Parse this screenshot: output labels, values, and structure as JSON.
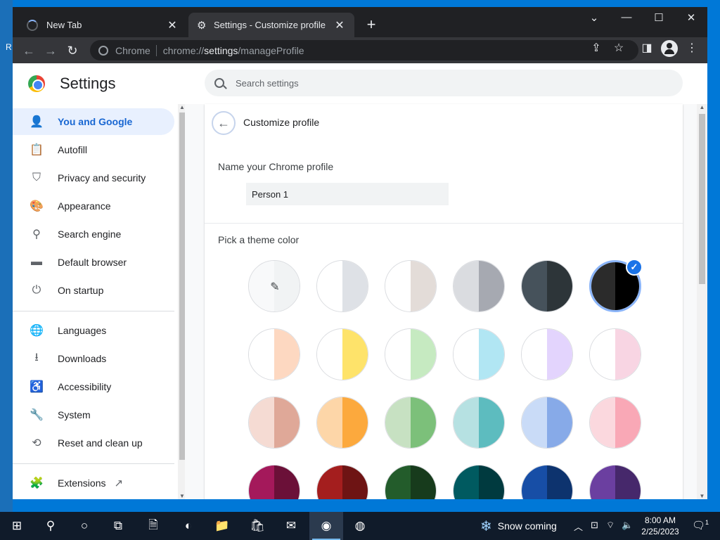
{
  "browser": {
    "tabs": [
      {
        "title": "New Tab",
        "state": "loading"
      },
      {
        "title": "Settings - Customize profile",
        "state": "active"
      }
    ],
    "omnibox": {
      "chip": "Chrome",
      "url_scheme": "chrome://",
      "url_host": "settings",
      "url_path": "/manageProfile"
    }
  },
  "settings": {
    "title": "Settings",
    "search_placeholder": "Search settings",
    "nav": {
      "items": [
        {
          "label": "You and Google",
          "icon": "person-icon",
          "selected": true
        },
        {
          "label": "Autofill",
          "icon": "clipboard-icon"
        },
        {
          "label": "Privacy and security",
          "icon": "shield-icon"
        },
        {
          "label": "Appearance",
          "icon": "palette-icon"
        },
        {
          "label": "Search engine",
          "icon": "search-icon"
        },
        {
          "label": "Default browser",
          "icon": "browser-window-icon"
        },
        {
          "label": "On startup",
          "icon": "power-icon"
        },
        {
          "label": "Languages",
          "icon": "globe-icon"
        },
        {
          "label": "Downloads",
          "icon": "download-icon"
        },
        {
          "label": "Accessibility",
          "icon": "accessibility-icon"
        },
        {
          "label": "System",
          "icon": "wrench-icon"
        },
        {
          "label": "Reset and clean up",
          "icon": "restore-icon"
        },
        {
          "label": "Extensions",
          "icon": "puzzle-icon"
        }
      ]
    },
    "page": {
      "title": "Customize profile",
      "name_label": "Name your Chrome profile",
      "name_value": "Person 1",
      "theme_label": "Pick a theme color"
    },
    "theme_colors": {
      "selected_index": 5,
      "swatches": [
        {
          "left": "#f8f9fa",
          "right": "#f1f3f4",
          "custom": true
        },
        {
          "left": "#ffffff",
          "right": "#dee1e6"
        },
        {
          "left": "#ffffff",
          "right": "#e3dcd8"
        },
        {
          "left": "#dadce0",
          "right": "#a6a9b1"
        },
        {
          "left": "#46525b",
          "right": "#2d3539"
        },
        {
          "left": "#2b2b2b",
          "right": "#000000"
        },
        {
          "left": "#ffffff",
          "right": "#fdd8c1"
        },
        {
          "left": "#ffffff",
          "right": "#fee36a"
        },
        {
          "left": "#ffffff",
          "right": "#c6eac1"
        },
        {
          "left": "#ffffff",
          "right": "#b1e6f3"
        },
        {
          "left": "#ffffff",
          "right": "#e3d4fd"
        },
        {
          "left": "#ffffff",
          "right": "#f8d5e3"
        },
        {
          "left": "#f5dbd3",
          "right": "#dfa898"
        },
        {
          "left": "#fdd6a8",
          "right": "#fca93d"
        },
        {
          "left": "#c7e1c2",
          "right": "#7cc07a"
        },
        {
          "left": "#b6e1e2",
          "right": "#5dbcbf"
        },
        {
          "left": "#c9dbf7",
          "right": "#87aae8"
        },
        {
          "left": "#fbd8de",
          "right": "#f9a8b6"
        },
        {
          "left": "#a4195b",
          "right": "#6b1038"
        },
        {
          "left": "#a41e1e",
          "right": "#6e1414"
        },
        {
          "left": "#235c2b",
          "right": "#173b1c"
        },
        {
          "left": "#005a60",
          "right": "#003a3f"
        },
        {
          "left": "#174ea6",
          "right": "#0d336e"
        },
        {
          "left": "#6b3fa0",
          "right": "#46286b"
        }
      ]
    }
  },
  "taskbar": {
    "weather_text": "Snow coming",
    "time": "8:00 AM",
    "date": "2/25/2023",
    "notification_count": "1"
  },
  "desktop": {
    "edge_letter": "R"
  }
}
